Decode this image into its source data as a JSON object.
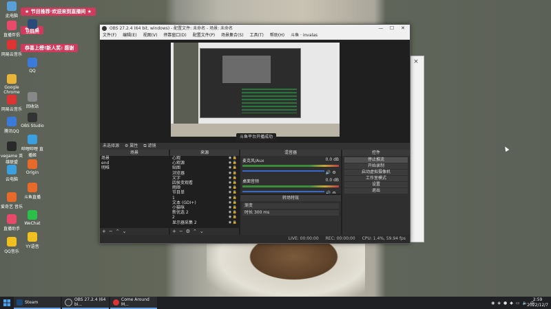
{
  "desktop": {
    "banners": [
      "★ 节目推荐·欢迎来到直播间 ★",
      "节目单",
      "恭喜上榜!新人奖: 感谢"
    ],
    "icons": [
      {
        "label": "此电脑",
        "color": "#5aa0d8"
      },
      {
        "label": "直播伴侣",
        "color": "#e84a6a"
      },
      {
        "label": "网易云音乐",
        "color": "#d33"
      },
      {
        "label": "Google Chrome",
        "color": "#e8b53a"
      },
      {
        "label": "网易云音乐",
        "color": "#d33"
      },
      {
        "label": "腾讯QQ",
        "color": "#3a7ad8"
      },
      {
        "label": "vegame 英雄联盟",
        "color": "#2a2a2a"
      },
      {
        "label": "云电脑",
        "color": "#3aa0e0"
      },
      {
        "label": "爱奇艺 音乐",
        "color": "#e86a2a"
      },
      {
        "label": "直播助手",
        "color": "#e84a6a"
      },
      {
        "label": "QQ音乐",
        "color": "#f0c020"
      },
      {
        "label": "Steam",
        "color": "#2a4a7a"
      },
      {
        "label": "QQ",
        "color": "#3a7ad8"
      },
      {
        "label": "回收站",
        "color": "#888"
      },
      {
        "label": "OBS Studio",
        "color": "#333"
      },
      {
        "label": "哔哩哔哩 直播姬",
        "color": "#3aa0e0"
      },
      {
        "label": "Origin",
        "color": "#e86a2a"
      },
      {
        "label": "斗鱼直播",
        "color": "#e86a2a"
      },
      {
        "label": "WeChat",
        "color": "#2ac04a"
      },
      {
        "label": "YY语音",
        "color": "#f0c020"
      }
    ]
  },
  "obs": {
    "title": "OBS 27.2.4 (64 bit, windows) - 配置文件: 未命名 - 场景: 未命名",
    "menu": [
      "文件(F)",
      "编辑(E)",
      "视图(V)",
      "停靠窗口(D)",
      "配置文件(P)",
      "场景集合(S)",
      "工具(T)",
      "帮助(H)",
      "斗鱼 · invalas"
    ],
    "toast": "斗鱼平台开播成功",
    "statusline": [
      "未选择源",
      "⚙ 属性",
      "⧉ 滤镜"
    ],
    "docks": {
      "scenes": {
        "title": "场景",
        "items": [
          "场景",
          "end",
          "明唯"
        ]
      },
      "sources": {
        "title": "来源",
        "items": [
          "心观",
          "心观源",
          "贴图",
          "浏览器",
          "文字",
          "四侯变观看",
          "雨顺",
          "节目单",
          "1",
          "文本 (GDI+)",
          "小猫咪",
          "新优选 2",
          "2",
          "显示器采集 2"
        ]
      },
      "mixer": {
        "title": "混音器",
        "tracks": [
          {
            "name": "麦克风/Aux",
            "db": "0.0 dB"
          },
          {
            "name": "桌面音频",
            "db": "0.0 dB"
          }
        ]
      },
      "transitions": {
        "title": "转场特效",
        "type": "渐变",
        "duration_label": "时长",
        "duration": "300 ms"
      },
      "controls": {
        "title": "控件",
        "buttons": [
          "停止推流",
          "开始录制",
          "启动虚拟摄像机",
          "工作室模式",
          "设置",
          "退出"
        ]
      }
    },
    "bottom_status": [
      "LIVE: 00:00:00",
      "REC: 00:00:00",
      "CPU: 1.4%, 59.94 fps"
    ]
  },
  "taskbar": {
    "tasks": [
      {
        "label": "Steam",
        "color": "#1b4a7a"
      },
      {
        "label": "OBS 27.2.4 (64 bi...",
        "color": "#333"
      },
      {
        "label": "Come Around M...",
        "color": "#d33"
      }
    ],
    "time": "2:59",
    "date": "2022/12/7"
  }
}
